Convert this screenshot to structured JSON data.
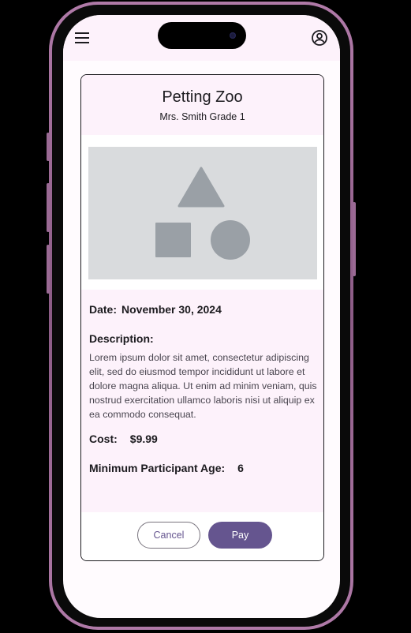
{
  "app_bar": {
    "menu_icon": "menu-icon",
    "account_icon": "account-circle-icon"
  },
  "card": {
    "title": "Petting Zoo",
    "subtitle": "Mrs. Smith Grade 1",
    "media_icon": "shapes-placeholder-icon",
    "date_label": "Date:",
    "date_value": "November 30, 2024",
    "description_label": "Description:",
    "description_text": "Lorem ipsum dolor sit amet, consectetur adipiscing elit, sed do eiusmod tempor incididunt ut labore et dolore magna aliqua. Ut enim ad minim veniam, quis nostrud exercitation ullamco laboris nisi ut aliquip ex ea commodo consequat.",
    "cost_label": "Cost:",
    "cost_value": "$9.99",
    "min_age_label": "Minimum Participant Age:",
    "min_age_value": "6"
  },
  "actions": {
    "cancel_label": "Cancel",
    "pay_label": "Pay"
  },
  "colors": {
    "primary": "#65558f",
    "surface": "#fdf2fb",
    "outline": "#79747e",
    "placeholder": "#d9dbdd",
    "placeholder_shape": "#9aa0a6",
    "frame": "#b07aa8"
  }
}
